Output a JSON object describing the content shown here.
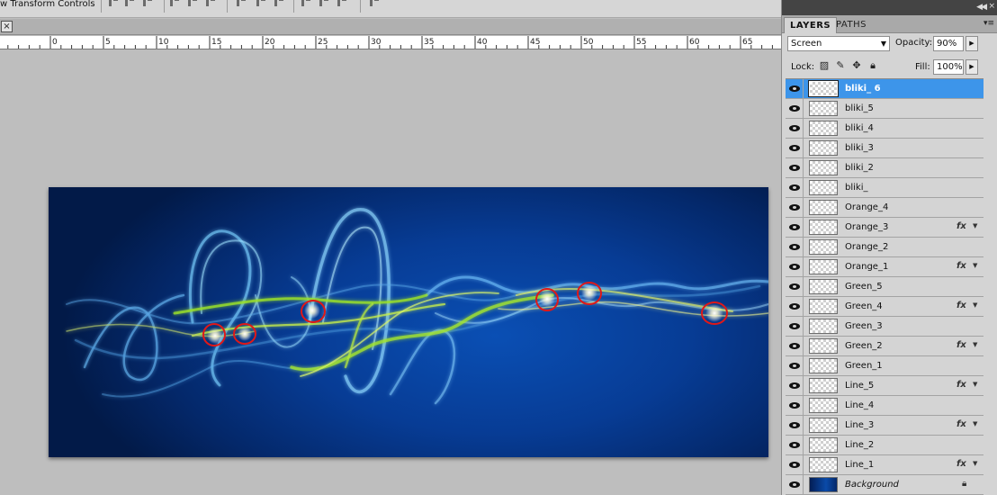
{
  "options_bar": {
    "transform_label": "w Transform Controls"
  },
  "tabstrip": {
    "close_symbol": "×"
  },
  "ruler": {
    "ticks": [
      "0",
      "5",
      "10",
      "15",
      "20",
      "25",
      "30",
      "35",
      "40",
      "45",
      "50",
      "55",
      "60",
      "65"
    ]
  },
  "panel": {
    "tabs": [
      {
        "label": "LAYERS",
        "active": true
      },
      {
        "label": "PATHS",
        "active": false
      }
    ],
    "blend_mode": "Screen",
    "opacity_label": "Opacity:",
    "opacity_value": "90%",
    "lock_label": "Lock:",
    "fill_label": "Fill:",
    "fill_value": "100%",
    "icons": {
      "collapse": "double-chevron-icon",
      "menu": "panel-menu-icon",
      "lock_transparent": "lock-transparent-icon",
      "lock_image": "brush-icon",
      "lock_position": "move-icon",
      "lock_all": "lock-icon",
      "visibility": "eye-icon",
      "effects": "fx-icon"
    }
  },
  "layers": [
    {
      "name": "bliki_ 6",
      "selected": true,
      "fx": false
    },
    {
      "name": "bliki_5",
      "selected": false,
      "fx": false
    },
    {
      "name": "bliki_4",
      "selected": false,
      "fx": false
    },
    {
      "name": "bliki_3",
      "selected": false,
      "fx": false
    },
    {
      "name": "bliki_2",
      "selected": false,
      "fx": false
    },
    {
      "name": "bliki_",
      "selected": false,
      "fx": false
    },
    {
      "name": "Orange_4",
      "selected": false,
      "fx": false
    },
    {
      "name": "Orange_3",
      "selected": false,
      "fx": true
    },
    {
      "name": "Orange_2",
      "selected": false,
      "fx": false
    },
    {
      "name": "Orange_1",
      "selected": false,
      "fx": true
    },
    {
      "name": "Green_5",
      "selected": false,
      "fx": false
    },
    {
      "name": "Green_4",
      "selected": false,
      "fx": true
    },
    {
      "name": "Green_3",
      "selected": false,
      "fx": false
    },
    {
      "name": "Green_2",
      "selected": false,
      "fx": true
    },
    {
      "name": "Green_1",
      "selected": false,
      "fx": false
    },
    {
      "name": "Line_5",
      "selected": false,
      "fx": true
    },
    {
      "name": "Line_4",
      "selected": false,
      "fx": false
    },
    {
      "name": "Line_3",
      "selected": false,
      "fx": true
    },
    {
      "name": "Line_2",
      "selected": false,
      "fx": false
    },
    {
      "name": "Line_1",
      "selected": false,
      "fx": true
    },
    {
      "name": "Background",
      "selected": false,
      "fx": false,
      "locked": true,
      "background": true
    }
  ],
  "colors": {
    "selection": "#3d95ea",
    "highlight_circle": "#e01818",
    "canvas_deep": "#021a48",
    "canvas_mid": "#0a4fb4"
  }
}
